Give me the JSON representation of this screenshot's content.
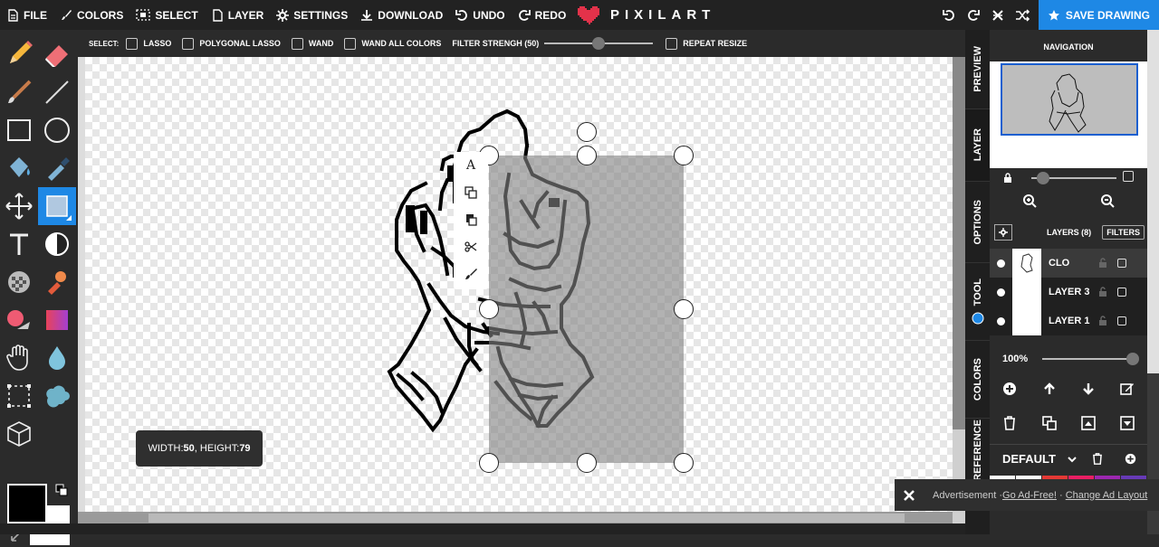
{
  "topbar": {
    "menu": [
      {
        "label": "FILE",
        "icon": "file-icon"
      },
      {
        "label": "COLORS",
        "icon": "brush-icon"
      },
      {
        "label": "SELECT",
        "icon": "select-icon"
      },
      {
        "label": "LAYER",
        "icon": "layer-icon"
      },
      {
        "label": "SETTINGS",
        "icon": "gear-icon"
      },
      {
        "label": "DOWNLOAD",
        "icon": "download-icon"
      },
      {
        "label": "UNDO",
        "icon": "undo-icon"
      },
      {
        "label": "REDO",
        "icon": "redo-icon"
      }
    ],
    "logo_text": "PIXILART",
    "save_label": "SAVE DRAWING"
  },
  "selectbar": {
    "prefix": "SELECT:",
    "options": [
      "LASSO",
      "POLYGONAL LASSO",
      "WAND",
      "WAND ALL COLORS"
    ],
    "filter_label": "FILTER STRENGH (50)",
    "filter_value": 50,
    "repeat_label": "REPEAT RESIZE"
  },
  "context_menu": {
    "items": [
      "text-icon",
      "copy-icon",
      "paste-icon",
      "cut-icon",
      "brush-icon"
    ],
    "text_glyph": "A"
  },
  "selection_info": {
    "width_label": "WIDTH: ",
    "width": "50",
    "sep": ", HEIGHT: ",
    "height": "79"
  },
  "side_tabs": [
    "PREVIEW",
    "LAYER",
    "OPTIONS",
    "TOOL",
    "COLORS",
    "REFERENCE"
  ],
  "panel": {
    "title": "NAVIGATION",
    "layers_title": "LAYERS (8)",
    "filters_label": "FILTERS",
    "layers": [
      {
        "name": "CLO",
        "active": true
      },
      {
        "name": "LAYER 3",
        "active": false
      },
      {
        "name": "LAYER 1",
        "active": false
      }
    ],
    "opacity": "100%",
    "palette_name": "DEFAULT",
    "palette_colors": [
      "#ffffff",
      "#ffffff",
      "#e53935",
      "#e91e63",
      "#9c27b0",
      "#673ab7"
    ]
  },
  "ad": {
    "label": "Advertisement · ",
    "link1": "Go Ad-Free!",
    "sep": " · ",
    "link2": "Change Ad Layout"
  }
}
